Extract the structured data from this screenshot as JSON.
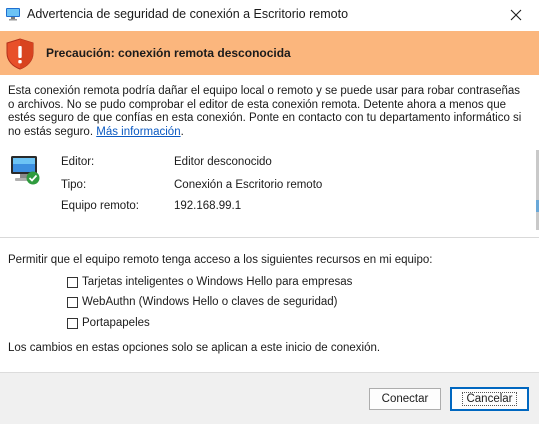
{
  "window": {
    "title": "Advertencia de seguridad de conexión a Escritorio remoto"
  },
  "banner": {
    "heading": "Precaución: conexión remota desconocida",
    "color": "#fbb67d"
  },
  "description": {
    "text": "Esta conexión remota podría dañar el equipo local o remoto y se puede usar para robar contraseñas o archivos. No se pudo comprobar el editor de esta conexión remota. Detente ahora a menos que estés seguro de que confías en esta conexión. Ponte en contacto con tu departamento informático si no estás seguro. ",
    "link": "Más información",
    "after_link": "."
  },
  "details": {
    "publisher_label": "Editor:",
    "publisher_value": "Editor desconocido",
    "type_label": "Tipo:",
    "type_value": "Conexión a Escritorio remoto",
    "computer_label": "Equipo remoto:",
    "computer_value": "192.168.99.1"
  },
  "permissions": {
    "intro": "Permitir que el equipo remoto tenga acceso a los siguientes recursos en mi equipo:",
    "options": [
      {
        "label": "Tarjetas inteligentes o Windows Hello para empresas",
        "checked": false
      },
      {
        "label": "WebAuthn (Windows Hello o claves de seguridad)",
        "checked": false
      },
      {
        "label": "Portapapeles",
        "checked": false
      }
    ],
    "note": "Los cambios en estas opciones solo se aplican a este inicio de conexión."
  },
  "buttons": {
    "connect": "Conectar",
    "cancel": "Cancelar"
  }
}
